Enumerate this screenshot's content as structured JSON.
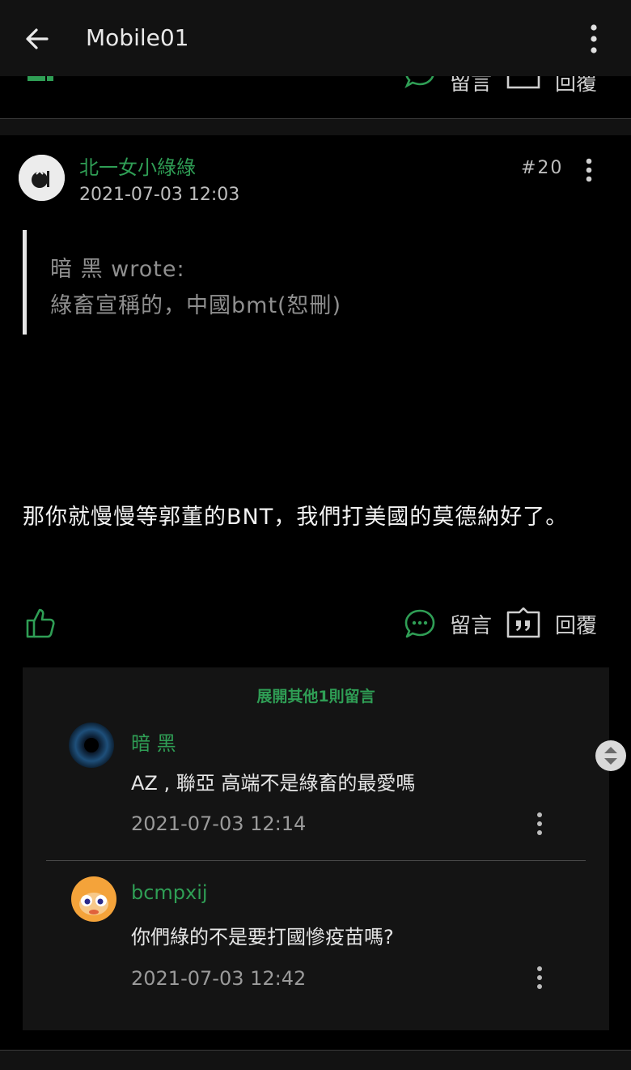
{
  "appbar": {
    "title": "Mobile01"
  },
  "previous_post": {
    "comment_label": "留言",
    "reply_label": "回覆"
  },
  "post": {
    "author": "北一女小綠綠",
    "timestamp": "2021-07-03 12:03",
    "floor": "#20",
    "quote": {
      "header": "暗 黑 wrote:",
      "text": "綠畜宣稱的，中國bmt(恕刪)"
    },
    "body": "那你就慢慢等郭董的BNT，我們打美國的莫德納好了。",
    "actions": {
      "comment_label": "留言",
      "reply_label": "回覆"
    }
  },
  "comments": {
    "expand_label": "展開其他1則留言",
    "items": [
      {
        "author": "暗 黑",
        "text": "AZ , 聯亞 高端不是綠畜的最愛嗎",
        "timestamp": "2021-07-03 12:14"
      },
      {
        "author": "bcmpxij",
        "text": "你們綠的不是要打國慘疫苗嗎?",
        "timestamp": "2021-07-03 12:42"
      }
    ]
  },
  "colors": {
    "accent": "#2f9e55",
    "background": "#000000",
    "surface": "#141414",
    "text": "#e6e6e6",
    "muted": "#9a9a9a"
  },
  "icons": [
    "back-arrow-icon",
    "more-vertical-icon",
    "thumbs-up-icon",
    "comment-bubble-icon",
    "quote-reply-icon",
    "scroll-handle-icon"
  ]
}
